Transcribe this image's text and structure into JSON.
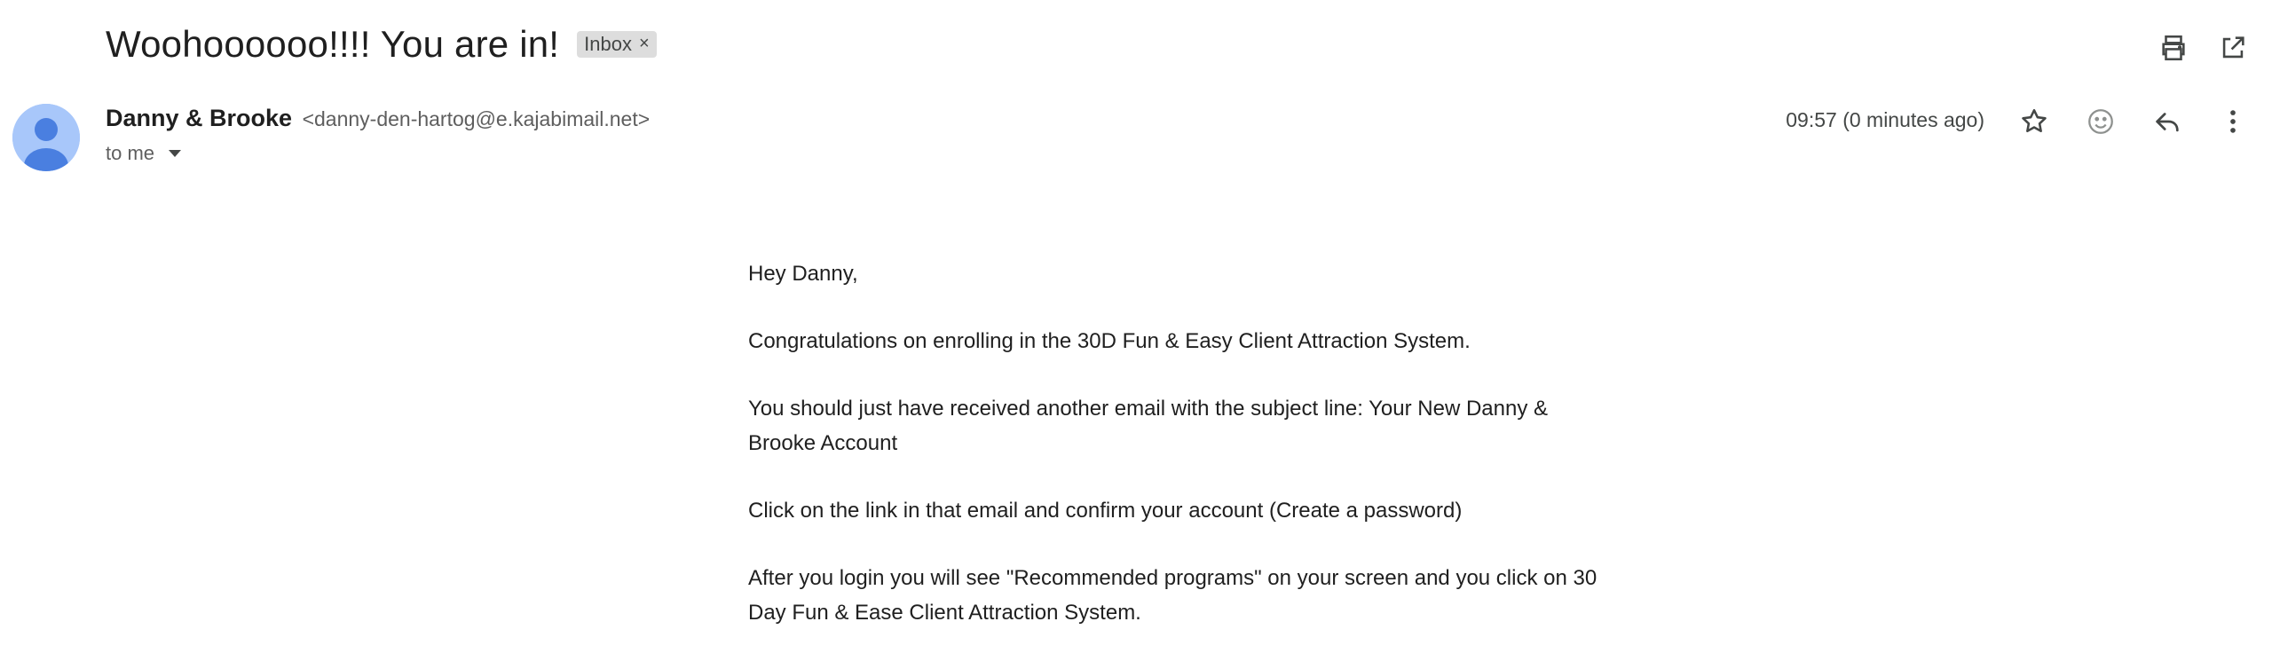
{
  "email": {
    "subject": "Woohoooooo!!!! You are in!",
    "label": "Inbox",
    "label_remove": "×",
    "sender_name": "Danny & Brooke",
    "sender_email": "<danny-den-hartog@e.kajabimail.net>",
    "recipient": "to me",
    "timestamp": "09:57 (0 minutes ago)",
    "body": [
      "Hey Danny,",
      "Congratulations on enrolling in the 30D Fun & Easy Client Attraction System.",
      "You should just have received another email with the subject line: Your New Danny & Brooke Account",
      "Click on the link in that email and confirm your account (Create a password)",
      "After you login you will see \"Recommended programs\" on your screen and you click on 30 Day Fun & Ease Client Attraction System."
    ]
  },
  "icons": {
    "print": "print-icon",
    "open_new_window": "open-in-new-window-icon",
    "star": "star-icon",
    "emoji": "emoji-reaction-icon",
    "reply": "reply-icon",
    "more": "more-vertical-icon",
    "avatar": "default-avatar-icon",
    "recipient_details": "chevron-down-icon"
  },
  "colors": {
    "avatar_bg": "#a8c7fa",
    "avatar_fg": "#4a7fe0",
    "label_chip_bg": "#dddddd"
  }
}
